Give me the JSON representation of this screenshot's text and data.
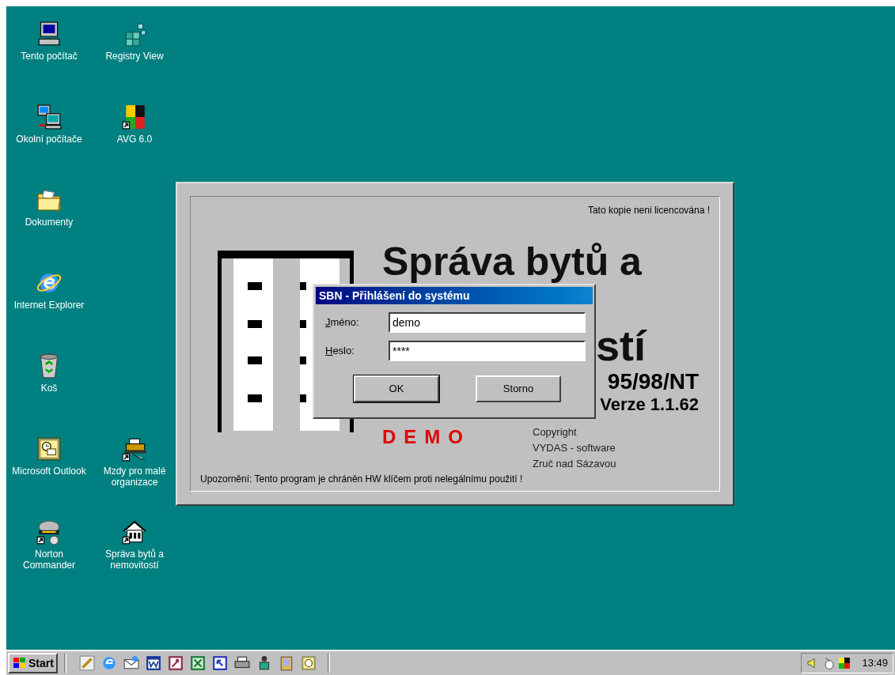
{
  "desktop_icon_rows": [
    [
      {
        "kind": "computer",
        "label": "Tento počítač"
      },
      {
        "kind": "cubes",
        "label": "Registry View"
      }
    ],
    [
      {
        "kind": "network",
        "label": "Okolní počítače"
      },
      {
        "kind": "avg",
        "label": "AVG 6.0"
      }
    ],
    [
      {
        "kind": "folder",
        "label": "Dokumenty"
      }
    ],
    [
      {
        "kind": "browser",
        "label": "Internet Explorer"
      }
    ],
    [
      {
        "kind": "bin",
        "label": "Koš"
      }
    ],
    [
      {
        "kind": "outlook",
        "label": "Microsoft Outlook"
      },
      {
        "kind": "printer",
        "label": "Mzdy pro malé organizace"
      }
    ],
    [
      {
        "kind": "hat",
        "label": "Norton Commander"
      },
      {
        "kind": "house",
        "label": "Správa bytů a nemovitostí"
      }
    ]
  ],
  "splash": {
    "license_note": "Tato kopie neni licencována !",
    "heading_line_1": "Správa bytů a",
    "heading_line_2": "stí",
    "platform": "95/98/NT",
    "version": "Verze 1.1.62",
    "demo": "DEMO",
    "copyright": [
      "Copyright",
      "VYDAS - software",
      "Zruč nad Sázavou"
    ],
    "warning": "Upozornění: Tento program je chráněn HW klíčem proti nelegálnímu použití !"
  },
  "login_dialog": {
    "title": "SBN - Přihlášení do systému",
    "fields": [
      {
        "label": "Jméno:",
        "value": "demo"
      },
      {
        "label": "Heslo:",
        "value": "****"
      }
    ],
    "buttons": [
      {
        "label": "OK",
        "focused": true
      },
      {
        "label": "Storno",
        "focused": false
      }
    ]
  },
  "taskbar": {
    "start": "Start",
    "clock": "13:49"
  }
}
